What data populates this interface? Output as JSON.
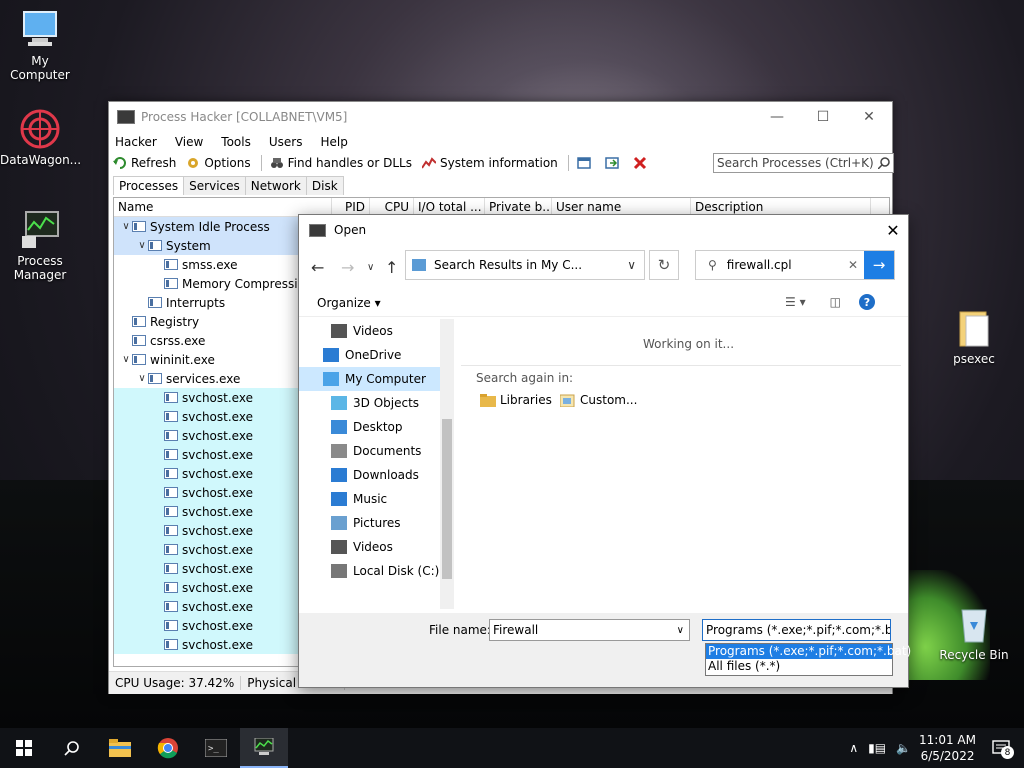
{
  "desktop": {
    "icons": [
      {
        "label": "My Computer"
      },
      {
        "label": "DataWagon..."
      },
      {
        "label": "Process Manager"
      },
      {
        "label": "psexec"
      },
      {
        "label": "Recycle Bin"
      }
    ]
  },
  "process_hacker": {
    "title": "Process Hacker [COLLABNET\\VM5]",
    "menu": [
      "Hacker",
      "View",
      "Tools",
      "Users",
      "Help"
    ],
    "toolbar": {
      "refresh": "Refresh",
      "options": "Options",
      "find_handles": "Find handles or DLLs",
      "system_info": "System information"
    },
    "search_placeholder": "Search Processes (Ctrl+K)",
    "tabs": [
      "Processes",
      "Services",
      "Network",
      "Disk"
    ],
    "columns": [
      "Name",
      "PID",
      "CPU",
      "I/O total ...",
      "Private b...",
      "User name",
      "Description"
    ],
    "rows": [
      {
        "name": "System Idle Process",
        "indent": 0,
        "expander": "v",
        "state": "sel"
      },
      {
        "name": "System",
        "indent": 1,
        "expander": "v",
        "state": "sel"
      },
      {
        "name": "smss.exe",
        "indent": 2,
        "expander": "",
        "state": ""
      },
      {
        "name": "Memory Compressi",
        "indent": 2,
        "expander": "",
        "state": ""
      },
      {
        "name": "Interrupts",
        "indent": 1,
        "expander": "",
        "state": ""
      },
      {
        "name": "Registry",
        "indent": 0,
        "expander": "",
        "state": ""
      },
      {
        "name": "csrss.exe",
        "indent": 0,
        "expander": "",
        "state": ""
      },
      {
        "name": "wininit.exe",
        "indent": 0,
        "expander": "v",
        "state": ""
      },
      {
        "name": "services.exe",
        "indent": 1,
        "expander": "v",
        "state": ""
      },
      {
        "name": "svchost.exe",
        "indent": 2,
        "expander": "",
        "state": "svc"
      },
      {
        "name": "svchost.exe",
        "indent": 2,
        "expander": "",
        "state": "svc"
      },
      {
        "name": "svchost.exe",
        "indent": 2,
        "expander": "",
        "state": "svc"
      },
      {
        "name": "svchost.exe",
        "indent": 2,
        "expander": "",
        "state": "svc"
      },
      {
        "name": "svchost.exe",
        "indent": 2,
        "expander": "",
        "state": "svc"
      },
      {
        "name": "svchost.exe",
        "indent": 2,
        "expander": "",
        "state": "svc"
      },
      {
        "name": "svchost.exe",
        "indent": 2,
        "expander": "",
        "state": "svc"
      },
      {
        "name": "svchost.exe",
        "indent": 2,
        "expander": "",
        "state": "svc"
      },
      {
        "name": "svchost.exe",
        "indent": 2,
        "expander": "",
        "state": "svc"
      },
      {
        "name": "svchost.exe",
        "indent": 2,
        "expander": "",
        "state": "svc"
      },
      {
        "name": "svchost.exe",
        "indent": 2,
        "expander": "",
        "state": "svc"
      },
      {
        "name": "svchost.exe",
        "indent": 2,
        "expander": "",
        "state": "svc"
      },
      {
        "name": "svchost.exe",
        "indent": 2,
        "expander": "",
        "state": "svc"
      },
      {
        "name": "svchost.exe",
        "indent": 2,
        "expander": "",
        "state": "svc"
      }
    ],
    "status": {
      "cpu": "CPU Usage: 37.42%",
      "physical": "Physical memo"
    }
  },
  "open_dialog": {
    "title": "Open",
    "address": "Search Results in My C...",
    "search_value": "firewall.cpl",
    "organize": "Organize",
    "nav_items": [
      {
        "label": "Videos",
        "icon": "video-icon",
        "indent": 1,
        "selected": false
      },
      {
        "label": "OneDrive",
        "icon": "cloud-icon",
        "indent": 0,
        "selected": false
      },
      {
        "label": "My Computer",
        "icon": "computer-icon",
        "indent": 0,
        "selected": true
      },
      {
        "label": "3D Objects",
        "icon": "cube-icon",
        "indent": 1,
        "selected": false
      },
      {
        "label": "Desktop",
        "icon": "desktop-icon",
        "indent": 1,
        "selected": false
      },
      {
        "label": "Documents",
        "icon": "document-icon",
        "indent": 1,
        "selected": false
      },
      {
        "label": "Downloads",
        "icon": "download-icon",
        "indent": 1,
        "selected": false
      },
      {
        "label": "Music",
        "icon": "music-icon",
        "indent": 1,
        "selected": false
      },
      {
        "label": "Pictures",
        "icon": "picture-icon",
        "indent": 1,
        "selected": false
      },
      {
        "label": "Videos",
        "icon": "video-icon",
        "indent": 1,
        "selected": false
      },
      {
        "label": "Local Disk (C:)",
        "icon": "drive-icon",
        "indent": 1,
        "selected": false
      }
    ],
    "working": "Working on it...",
    "search_again": "Search again in:",
    "libraries": "Libraries",
    "custom": "Custom...",
    "file_name_label": "File name:",
    "file_name_value": "Firewall",
    "filter_value": "Programs (*.exe;*.pif;*.com;*.bat)",
    "filter_options": [
      "Programs (*.exe;*.pif;*.com;*.bat)",
      "All files (*.*)"
    ]
  },
  "taskbar": {
    "time": "11:01 AM",
    "date": "6/5/2022",
    "notifications": "8"
  }
}
